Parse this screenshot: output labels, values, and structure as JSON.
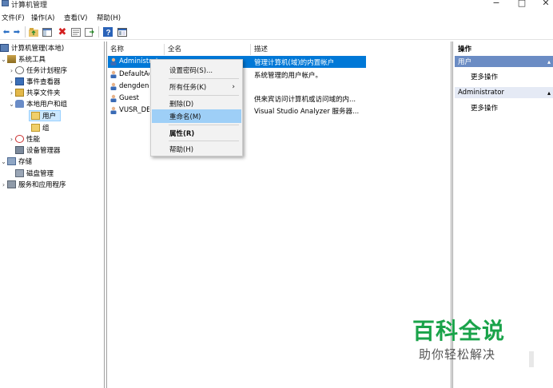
{
  "window": {
    "title": "计算机管理",
    "minimize": "−",
    "maximize": "□",
    "close": "✕"
  },
  "menu": [
    "文件(F)",
    "操作(A)",
    "查看(V)",
    "帮助(H)"
  ],
  "tree": {
    "items": [
      {
        "label": "计算机管理(本地)"
      },
      {
        "label": "系统工具"
      },
      {
        "label": "任务计划程序"
      },
      {
        "label": "事件查看器"
      },
      {
        "label": "共享文件夹"
      },
      {
        "label": "本地用户和组"
      },
      {
        "label": "用户"
      },
      {
        "label": "组"
      },
      {
        "label": "性能"
      },
      {
        "label": "设备管理器"
      },
      {
        "label": "存储"
      },
      {
        "label": "磁盘管理"
      },
      {
        "label": "服务和应用程序"
      }
    ]
  },
  "list": {
    "columns": [
      "名称",
      "全名",
      "描述"
    ],
    "rows": [
      {
        "name": "Administrator",
        "fullname": "",
        "desc": "管理计算机(域)的内置帐户"
      },
      {
        "name": "DefaultAccount",
        "fullname": "",
        "desc": "系统管理的用户帐户。"
      },
      {
        "name": "dengdeng",
        "fullname": "",
        "desc": ""
      },
      {
        "name": "Guest",
        "fullname": "",
        "desc": "供来宾访问计算机或访问域的内..."
      },
      {
        "name": "VUSR_DEVENV",
        "fullname": "",
        "desc": "Visual Studio Analyzer 服务器..."
      }
    ]
  },
  "actions": {
    "title": "操作",
    "group1": "用户",
    "more1": "更多操作",
    "group2": "Administrator",
    "more2": "更多操作"
  },
  "context_menu": {
    "set_password": "设置密码(S)...",
    "all_tasks": "所有任务(K)",
    "delete": "删除(D)",
    "rename": "重命名(M)",
    "properties": "属性(R)",
    "help": "帮助(H)"
  },
  "watermark": {
    "title": "百科全说",
    "subtitle": "助你轻松解决"
  },
  "colors": {
    "selection_blue": "#0078d7",
    "highlight": "#9ecff7",
    "watermark_green": "#1aa34a"
  }
}
